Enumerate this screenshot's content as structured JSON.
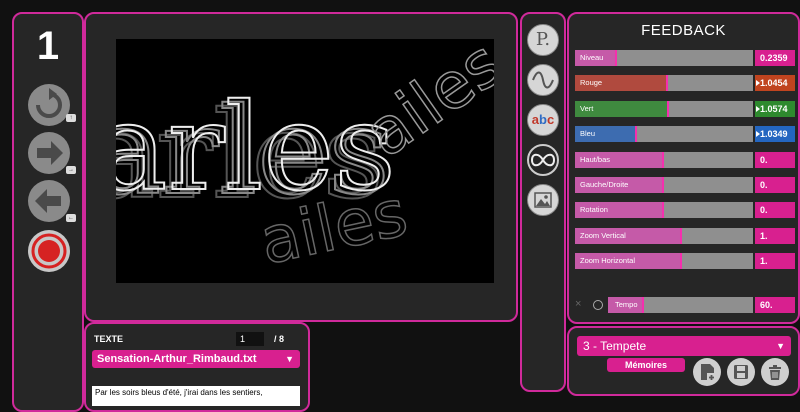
{
  "left_panel": {
    "step_number": "1"
  },
  "texte": {
    "label": "TEXTE",
    "page": "1",
    "total": "/ 8",
    "file": "Sensation-Arthur_Rimbaud.txt",
    "content": "Par les soirs bleus d'été, j'irai dans les sentiers,"
  },
  "tabs": {
    "p_label": "P.",
    "abc_label": "abc"
  },
  "feedback": {
    "title": "FEEDBACK",
    "sliders": [
      {
        "label": "Niveau",
        "value": "0.2359",
        "level": 0.2359,
        "value_color": "#d8208f",
        "fill_color": "#c55aa8",
        "arrow": false
      },
      {
        "label": "Rouge",
        "value": "1.0454",
        "level": 0.52,
        "value_color": "#c0441f",
        "fill_color": "#b04a3e",
        "arrow": true
      },
      {
        "label": "Vert",
        "value": "1.0574",
        "level": 0.53,
        "value_color": "#2e8a2e",
        "fill_color": "#3f8a3f",
        "arrow": true
      },
      {
        "label": "Bleu",
        "value": "1.0349",
        "level": 0.35,
        "value_color": "#2466c0",
        "fill_color": "#3d6cb0",
        "arrow": true
      },
      {
        "label": "Haut/bas",
        "value": "0.",
        "level": 0.5,
        "value_color": "#d8208f",
        "fill_color": "#c55aa8",
        "arrow": false
      },
      {
        "label": "Gauche/Droite",
        "value": "0.",
        "level": 0.5,
        "value_color": "#d8208f",
        "fill_color": "#c55aa8",
        "arrow": false
      },
      {
        "label": "Rotation",
        "value": "0.",
        "level": 0.5,
        "value_color": "#d8208f",
        "fill_color": "#c55aa8",
        "arrow": false
      },
      {
        "label": "Zoom Vertical",
        "value": "1.",
        "level": 0.6,
        "value_color": "#d8208f",
        "fill_color": "#c55aa8",
        "arrow": false
      },
      {
        "label": "Zoom Horizontal",
        "value": "1.",
        "level": 0.6,
        "value_color": "#d8208f",
        "fill_color": "#c55aa8",
        "arrow": false
      }
    ],
    "tempo": {
      "label": "Tempo",
      "value": "60."
    }
  },
  "presets": {
    "selected": "3 - Tempete",
    "memoires_label": "Mémoires"
  },
  "viewport_text": {
    "line1": "arles",
    "line2": "ailes"
  },
  "colors": {
    "accent": "#d02a9b",
    "panel": "#262626",
    "background": "#111111"
  }
}
